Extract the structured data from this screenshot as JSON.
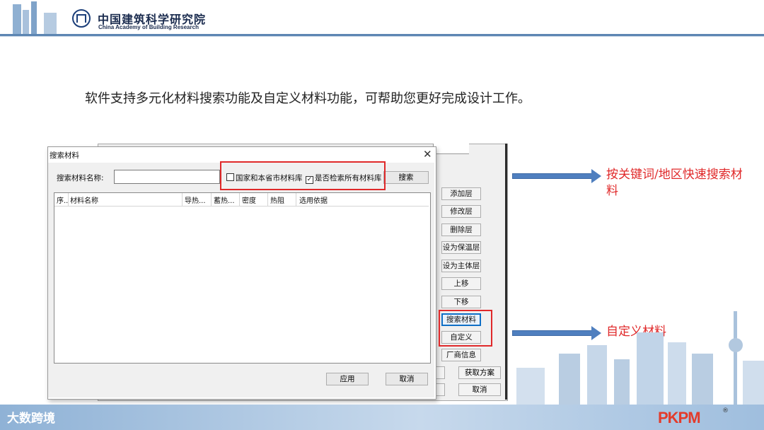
{
  "header": {
    "org_name_cn": "中国建筑科学研究院",
    "org_name_en": "China Academy of Building Research"
  },
  "intro_text": "软件支持多元化材料搜索功能及自定义材料功能，可帮助您更好完成设计工作。",
  "dialog": {
    "title": "搜索材料",
    "close_glyph": "✕",
    "search_label": "搜索材料名称:",
    "search_value": "",
    "checkbox_local": {
      "label": "国家和本省市材料库",
      "checked": false
    },
    "checkbox_all": {
      "label": "是否检索所有材料库",
      "checked": true
    },
    "search_button": "搜索",
    "columns": [
      "序..",
      "材料名称",
      "导热...",
      "蓄热...",
      "密度",
      "热阻",
      "选用依据"
    ],
    "rows": [],
    "apply_button": "应用",
    "cancel_button": "取消"
  },
  "side_panel": {
    "buttons": [
      "添加层",
      "修改层",
      "删除层",
      "设为保温层",
      "设为主体层",
      "上移",
      "下移",
      "搜索材料",
      "自定义",
      "厂商信息"
    ],
    "get_plan_button": "获取方案",
    "cancel_button": "取消"
  },
  "annotations": {
    "search_note": "按关键词/地区快速搜索材料",
    "custom_note": "自定义材料"
  },
  "footer": {
    "brand_left": "大数跨境",
    "brand_right": "PKPM",
    "registered_mark": "®"
  },
  "colors": {
    "accent_red": "#e0292a",
    "arrow_blue": "#4f7fbf",
    "header_blue": "#5d86b3"
  }
}
